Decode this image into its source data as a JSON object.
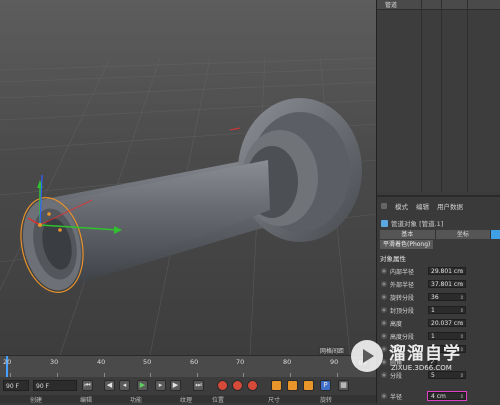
{
  "object_manager": {
    "top_item": "管道"
  },
  "attributes": {
    "menu": [
      "模式",
      "编辑",
      "用户数据"
    ],
    "object_title": "管道对象 [管道.1]",
    "tabs": [
      "基本",
      "坐标",
      ""
    ],
    "subtab": "平滑着色(Phong)",
    "section_title": "对象属性",
    "properties": [
      {
        "label": "内部半径",
        "value": "29.801 cm"
      },
      {
        "label": "外部半径",
        "value": "37.801 cm"
      },
      {
        "label": "旋转分段",
        "value": "36"
      },
      {
        "label": "封顶分段",
        "value": "1"
      },
      {
        "label": "高度",
        "value": "20.037 cm"
      },
      {
        "label": "高度分段",
        "value": "1"
      },
      {
        "label": "方向",
        "value": "+Y"
      },
      {
        "label": "圆角",
        "value": ""
      },
      {
        "label": "分段",
        "value": "5"
      },
      {
        "label": "半径",
        "value": "4 cm"
      }
    ]
  },
  "timeline": {
    "ruler": [
      "20",
      "30",
      "40",
      "50",
      "60",
      "70",
      "80",
      "90"
    ],
    "current_frame": "0 F",
    "material_label": "网格间距"
  },
  "transport": {
    "start_field": "90 F",
    "end_field": "90 F"
  },
  "statusbar": {
    "labels": [
      "创建",
      "编辑",
      "功能",
      "纹理",
      "位置",
      "尺寸",
      "旋转"
    ]
  },
  "watermark": {
    "title": "溜溜自学",
    "url": "ZIXUE.3D66.COM"
  },
  "colors": {
    "accent": "#3fa0e6",
    "highlight": "#e040c8",
    "axis_x": "#e03030",
    "axis_y": "#30c030",
    "axis_z": "#3060ff"
  }
}
